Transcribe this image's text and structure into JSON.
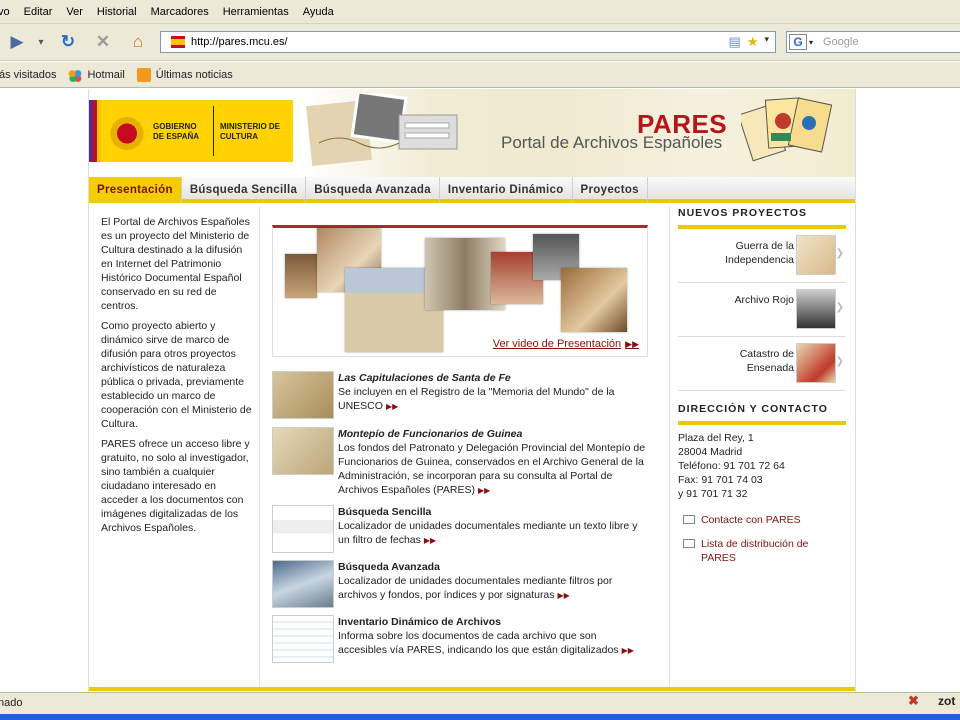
{
  "browser": {
    "menu": [
      "vo",
      "Editar",
      "Ver",
      "Historial",
      "Marcadores",
      "Herramientas",
      "Ayuda"
    ],
    "url": "http://pares.mcu.es/",
    "search_placeholder": "Google",
    "bookmarks": [
      "ás visitados",
      "Hotmail",
      "Últimas noticias"
    ],
    "status": "nado",
    "status_right": "zot"
  },
  "header": {
    "gov_text": "GOBIERNO DE ESPAÑA",
    "ministry_text": "MINISTERIO DE CULTURA",
    "title": "PARES",
    "subtitle": "Portal de Archivos Españoles"
  },
  "tabs": [
    "Presentación",
    "Búsqueda Sencilla",
    "Búsqueda Avanzada",
    "Inventario Dinámico",
    "Proyectos"
  ],
  "intro": [
    "El Portal de Archivos Españoles es un proyecto del Ministerio de Cultura destinado a la difusión en Internet del Patrimonio Histórico Documental Español conservado en su red de centros.",
    "Como proyecto abierto y dinámico sirve de marco de difusión para otros proyectos archivísticos de naturaleza pública o privada, previamente establecido un marco de cooperación con el Ministerio de Cultura.",
    "PARES ofrece un acceso libre y gratuito, no solo al investigador, sino también a cualquier ciudadano interesado en acceder a los documentos con imágenes digitalizadas de los Archivos Españoles."
  ],
  "banner": {
    "video_link": "Ver video de Presentación"
  },
  "features": [
    {
      "title": "Las Capitulaciones de Santa de Fe",
      "text": "Se incluyen en el Registro de la \"Memoria del Mundo\" de la UNESCO",
      "italic": true
    },
    {
      "title": "Montepío de Funcionarios de Guinea",
      "text": "Los fondos del Patronato y Delegación Provincial del Montepío de Funcionarios de Guinea, conservados en el Archivo General de la Administración, se incorporan para su consulta al Portal de Archivos Españoles (PARES)",
      "italic": true
    },
    {
      "title": "Búsqueda Sencilla",
      "text": "Localizador de unidades documentales mediante un texto libre y un filtro de fechas",
      "italic": false
    },
    {
      "title": "Búsqueda Avanzada",
      "text": "Localizador de unidades documentales mediante filtros por archivos y fondos, por índices y por signaturas",
      "italic": false
    },
    {
      "title": "Inventario Dinámico de Archivos",
      "text": "Informa sobre los documentos de cada archivo que son accesibles vía PARES, indicando los que están digitalizados",
      "italic": false
    }
  ],
  "right": {
    "projects_heading": "NUEVOS PROYECTOS",
    "projects": [
      "Guerra de la Independencia",
      "Archivo Rojo",
      "Catastro de Ensenada"
    ],
    "contact_heading": "DIRECCIÓN Y CONTACTO",
    "address": [
      "Plaza del Rey, 1",
      "28004 Madrid",
      "Teléfono: 91 701 72 64",
      "Fax: 91 701 74 03",
      "y 91 701 71 32"
    ],
    "links": [
      "Contacte con PARES",
      "Lista de distribución de PARES"
    ]
  }
}
